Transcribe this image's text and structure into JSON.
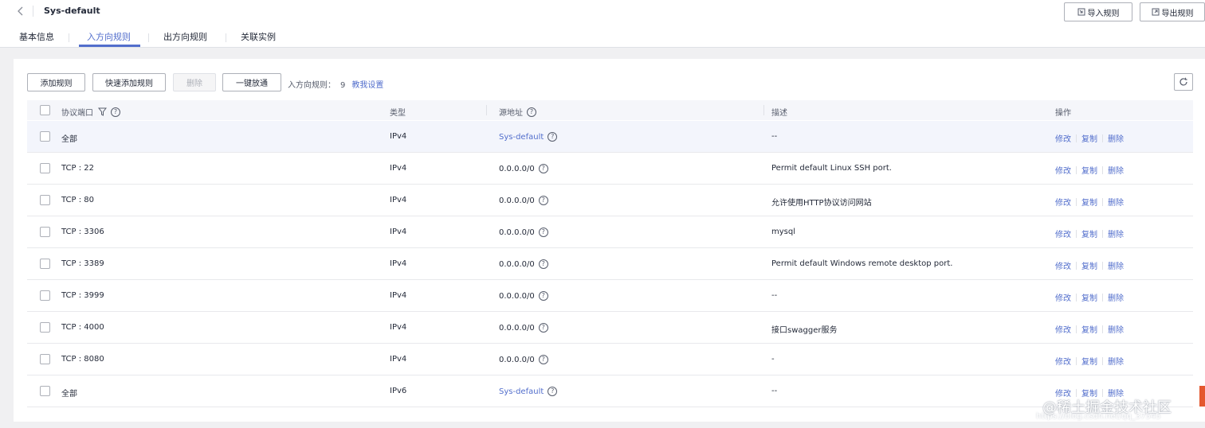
{
  "header": {
    "back_icon": "chevron-left-icon",
    "title": "Sys-default",
    "import_label": "导入规则",
    "export_label": "导出规则"
  },
  "tabs": [
    {
      "label": "基本信息",
      "active": false
    },
    {
      "label": "入方向规则",
      "active": true
    },
    {
      "label": "出方向规则",
      "active": false
    },
    {
      "label": "关联实例",
      "active": false
    }
  ],
  "toolbar": {
    "add_rule": "添加规则",
    "quick_add_rule": "快速添加规则",
    "delete": "删除",
    "one_click_open": "一键放通",
    "count_label": "入方向规则：",
    "count_value": "9",
    "help_link": "教我设置"
  },
  "table": {
    "columns": {
      "protocol_port": "协议端口",
      "type": "类型",
      "source": "源地址",
      "description": "描述",
      "actions": "操作"
    },
    "actions": {
      "edit": "修改",
      "copy": "复制",
      "delete": "删除"
    },
    "rows": [
      {
        "protocol_port": "全部",
        "type": "IPv4",
        "source": "Sys-default",
        "source_is_link": true,
        "description": "--"
      },
      {
        "protocol_port": "TCP : 22",
        "type": "IPv4",
        "source": "0.0.0.0/0",
        "source_is_link": false,
        "description": "Permit default Linux SSH port."
      },
      {
        "protocol_port": "TCP : 80",
        "type": "IPv4",
        "source": "0.0.0.0/0",
        "source_is_link": false,
        "description": "允许使用HTTP协议访问网站"
      },
      {
        "protocol_port": "TCP : 3306",
        "type": "IPv4",
        "source": "0.0.0.0/0",
        "source_is_link": false,
        "description": "mysql"
      },
      {
        "protocol_port": "TCP : 3389",
        "type": "IPv4",
        "source": "0.0.0.0/0",
        "source_is_link": false,
        "description": "Permit default Windows remote desktop port."
      },
      {
        "protocol_port": "TCP : 3999",
        "type": "IPv4",
        "source": "0.0.0.0/0",
        "source_is_link": false,
        "description": "--"
      },
      {
        "protocol_port": "TCP : 4000",
        "type": "IPv4",
        "source": "0.0.0.0/0",
        "source_is_link": false,
        "description": "接口swagger服务"
      },
      {
        "protocol_port": "TCP : 8080",
        "type": "IPv4",
        "source": "0.0.0.0/0",
        "source_is_link": false,
        "description": "-"
      },
      {
        "protocol_port": "全部",
        "type": "IPv6",
        "source": "Sys-default",
        "source_is_link": true,
        "description": "--"
      }
    ]
  },
  "watermark": {
    "text": "@稀土掘金技术社区",
    "url": "https://blog.csdn.net/qq_37545"
  },
  "colors": {
    "accent": "#526ecc",
    "text": "#252b3a",
    "muted": "#575d6c",
    "border": "#adb0b8",
    "header_bg": "#f5f6fa",
    "highlight_row": "#f3f5fc"
  }
}
